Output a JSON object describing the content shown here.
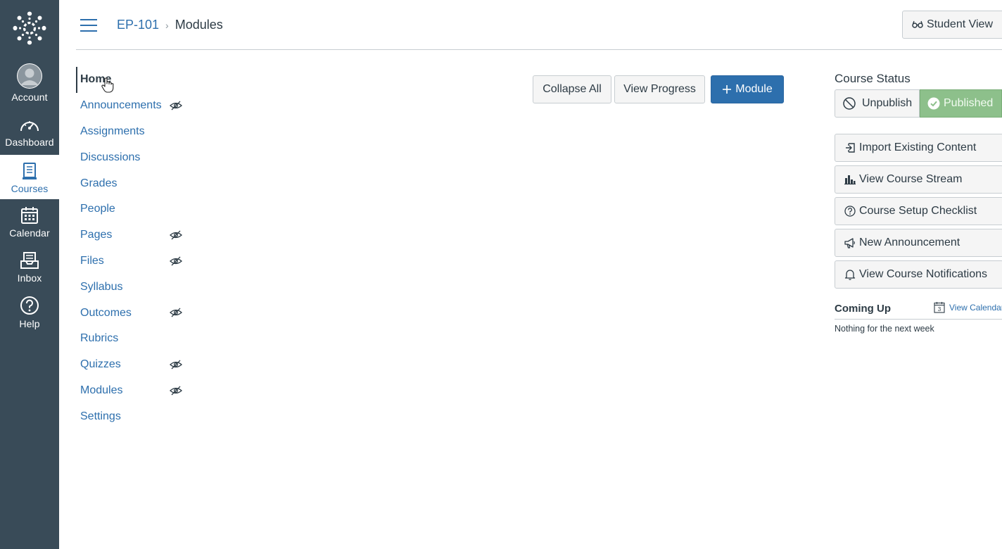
{
  "global_nav": {
    "items": [
      {
        "label": "Account",
        "icon": "account-avatar-icon"
      },
      {
        "label": "Dashboard",
        "icon": "dashboard-gauge-icon"
      },
      {
        "label": "Courses",
        "icon": "courses-book-icon",
        "active": true
      },
      {
        "label": "Calendar",
        "icon": "calendar-icon"
      },
      {
        "label": "Inbox",
        "icon": "inbox-icon"
      },
      {
        "label": "Help",
        "icon": "help-question-icon"
      }
    ]
  },
  "header": {
    "breadcrumb": {
      "course": "EP-101",
      "separator": "›",
      "current": "Modules"
    },
    "student_view_label": "Student View"
  },
  "course_nav": {
    "items": [
      {
        "label": "Home",
        "active": true,
        "hidden": false
      },
      {
        "label": "Announcements",
        "hidden": true
      },
      {
        "label": "Assignments",
        "hidden": false
      },
      {
        "label": "Discussions",
        "hidden": false
      },
      {
        "label": "Grades",
        "hidden": false
      },
      {
        "label": "People",
        "hidden": false
      },
      {
        "label": "Pages",
        "hidden": true
      },
      {
        "label": "Files",
        "hidden": true
      },
      {
        "label": "Syllabus",
        "hidden": false
      },
      {
        "label": "Outcomes",
        "hidden": true
      },
      {
        "label": "Rubrics",
        "hidden": false
      },
      {
        "label": "Quizzes",
        "hidden": true
      },
      {
        "label": "Modules",
        "hidden": true
      },
      {
        "label": "Settings",
        "hidden": false
      }
    ]
  },
  "toolbar": {
    "collapse_all_label": "Collapse All",
    "view_progress_label": "View Progress",
    "add_module_label": "Module"
  },
  "sidebar": {
    "course_status_title": "Course Status",
    "unpublish_label": "Unpublish",
    "published_label": "Published",
    "actions": [
      {
        "label": "Import Existing Content",
        "icon": "import-icon"
      },
      {
        "label": "View Course Stream",
        "icon": "bar-chart-icon"
      },
      {
        "label": "Course Setup Checklist",
        "icon": "question-circle-icon"
      },
      {
        "label": "New Announcement",
        "icon": "megaphone-icon"
      },
      {
        "label": "View Course Notifications",
        "icon": "bell-icon"
      }
    ],
    "coming_up_title": "Coming Up",
    "view_calendar_label": "View Calendar",
    "calendar_day": "3",
    "nothing_text": "Nothing for the next week"
  },
  "colors": {
    "nav_bg": "#394b58",
    "link_blue": "#2d6fad",
    "published_green": "#8dc08b",
    "text_dark": "#2d3b45"
  }
}
